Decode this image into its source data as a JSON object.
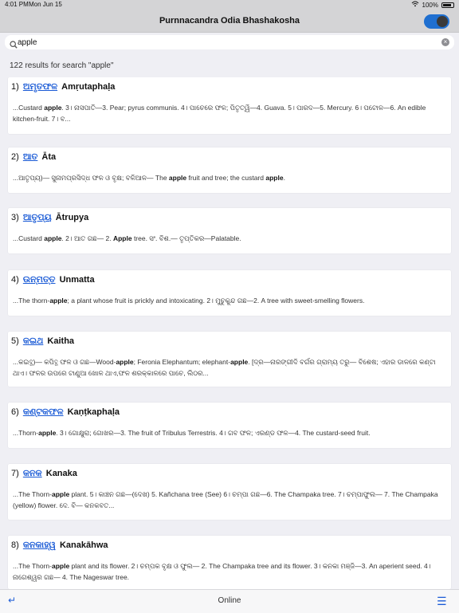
{
  "status": {
    "time": "4:01 PM",
    "date": "Mon Jun 15",
    "wifi_icon": "wifi-icon",
    "battery_text": "100%"
  },
  "nav": {
    "title": "Purnnacandra Odia Bhashakosha",
    "toggle": {
      "state": "on",
      "colors": {
        "on": "#1f6fd0"
      }
    }
  },
  "search": {
    "query": "apple",
    "placeholder": "",
    "icon": "search-icon",
    "clear_icon": "clear-icon"
  },
  "results": {
    "summary": "122 results for search \"apple\"",
    "items": [
      {
        "num": "1)",
        "odia": "ଅମୃତଫଳ",
        "latin": "Amṛutaphaḷa",
        "definition": "...Custard apple. 3। ନାସପାତି—3. Pear; pyrus communis. 4। ପାଚେରେ ଫଳ; ପିତୃତ୍ୱି—4. Guava. 5। ପାରଦ—5. Mercury. 6। ପଟୋଳ—6. An edible kitchen-fruit. 7। ବ..."
      },
      {
        "num": "2)",
        "odia": "ଆତ",
        "latin": "Āta",
        "definition": "...ଆତୃପ୍ୟ)— ସୁନାମପ୍ରସିଦ୍ଧ ଫଳ ଓ ବୃକ୍ଷ; ବଳିଆଳ— The apple fruit and tree; the custard apple."
      },
      {
        "num": "3)",
        "odia": "ଆତୃପ୍ୟ",
        "latin": "Ātrupya",
        "definition": "...Custard apple. 2। ଆତ ଗଛ— 2. Apple tree. ସଂ. ବିଶ.— ତୃପ୍ତିକର—Palatable."
      },
      {
        "num": "4)",
        "odia": "ଉନ୍ମତ୍ତ",
        "latin": "Unmatta",
        "definition": "...The thorn-apple; a plant whose fruit is prickly and intoxicating. 2। ମୁଚୁକୁନ୍ଦ ଗଛ—2. A tree with sweet-smelling flowers."
      },
      {
        "num": "5)",
        "odia": "କଇଥ",
        "latin": "Kaitha",
        "definition": "...କଇତ୍ଥ)— କପିତ୍ଥ ଫଳ ଓ ଗଛ—Wood-apple; Feronia Elephantum; elephant-apple. [ଦ୍ର—ନାରଙ୍ଗୀଦି ବର୍ଗର ଗ୍ରାମ୍ୟ ତରୁ— ବିଶେଷ; ଏହାର ଡାଳରେ କଣ୍ଟା ଥାଏ। ଫଳର ଉପରେ ଟାଣୁଆ ଖୋଳ ଥାଏ,ଫଳ ଶରକ୍କାଳରେ ପାଚେ, ଲିଠର..."
      },
      {
        "num": "6)",
        "odia": "କଣ୍ଟକଫଳ",
        "latin": "Kaṇṭkaphaḷa",
        "definition": "...Thorn-apple. 3। ଗୋକ୍ଷୁରା; ଗୋଖର—3. The fruit of Tribulus Terrestris. 4। ଗବ ଫଳ; ଏରଣ୍ଡ ଫଳ—4. The custard-seed fruit."
      },
      {
        "num": "7)",
        "odia": "କନକ",
        "latin": "Kanaka",
        "definition": "...The Thorn-apple plant. 5। କାଞ୍ଚନ ଗଛ—(ଦେଖ) 5. Kañchana tree (See) 6। ଚମ୍ପା ଗଛ—6. The Champaka tree. 7। ଚମ୍ପାଫୁଲ— 7. The Champaka (yellow) flower. ଦେ. ବି— କନକବତ..."
      },
      {
        "num": "8)",
        "odia": "କନକାହ୍ୱ",
        "latin": "Kanakāhwa",
        "definition": "...The Thorn-apple plant and its flower. 2। ଚମ୍ପକ ବୃକ୍ଷ ଓ ଫୁଲ— 2. The Champaka tree and its flower. 3। କନକା ମଞ୍ଜି—3. An aperient seed. 4। ନାଗେଶ୍ୱର ଗଛ— 4. The Nageswar tree."
      }
    ]
  },
  "bottombar": {
    "left_icon": "return-icon",
    "center": "Online",
    "right_icon": "menu-icon"
  }
}
